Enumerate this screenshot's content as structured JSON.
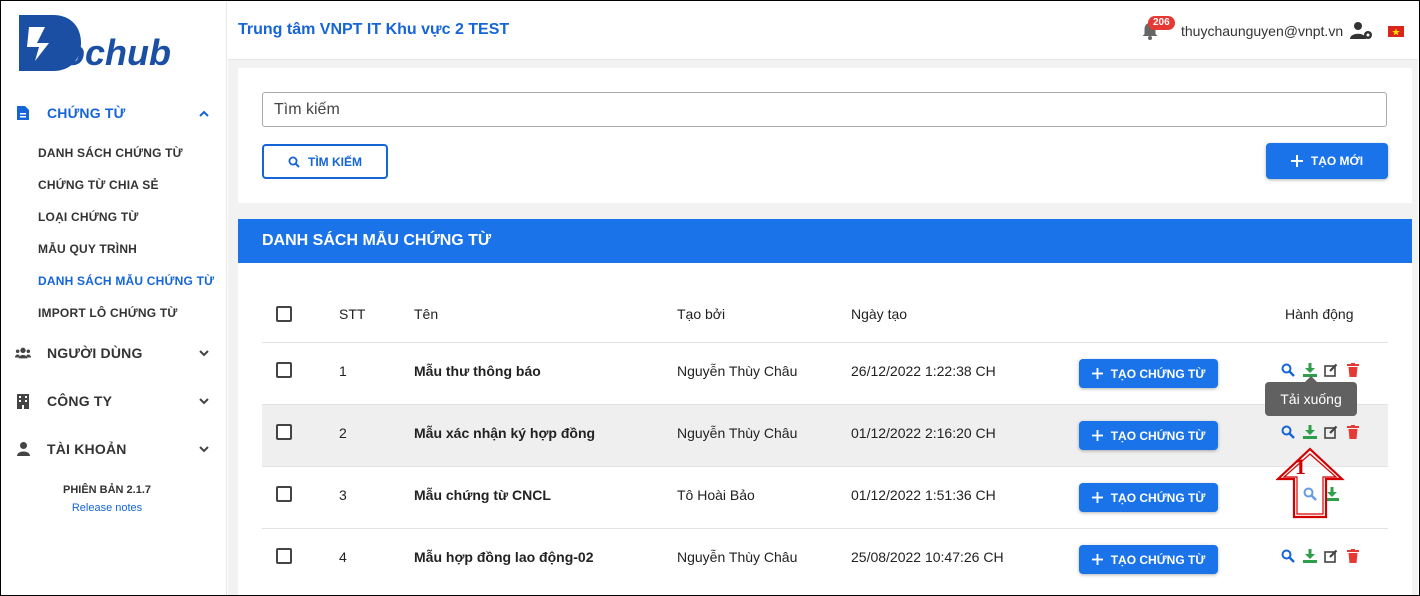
{
  "sidebar": {
    "logo_text": "Dochub",
    "groups": [
      {
        "label": "CHỨNG TỪ",
        "icon": "document-icon",
        "expanded": true
      },
      {
        "label": "NGƯỜI DÙNG",
        "icon": "users-icon",
        "expanded": false
      },
      {
        "label": "CÔNG TY",
        "icon": "building-icon",
        "expanded": false
      },
      {
        "label": "TÀI KHOẢN",
        "icon": "user-icon",
        "expanded": false
      }
    ],
    "subitems": [
      {
        "label": "DANH SÁCH CHỨNG TỪ",
        "active": false
      },
      {
        "label": "CHỨNG TỪ CHIA SẺ",
        "active": false
      },
      {
        "label": "LOẠI CHỨNG TỪ",
        "active": false
      },
      {
        "label": "MẪU QUY TRÌNH",
        "active": false
      },
      {
        "label": "DANH SÁCH MẪU CHỨNG TỪ",
        "active": true
      },
      {
        "label": "IMPORT LÔ CHỨNG TỪ",
        "active": false
      }
    ],
    "version": "PHIÊN BẢN 2.1.7",
    "release_notes": "Release notes"
  },
  "header": {
    "title": "Trung tâm VNPT IT Khu vực 2 TEST",
    "notification_count": "206",
    "user_email": "thuychaunguyen@vnpt.vn",
    "language_flag": "vietnam-flag-icon"
  },
  "search": {
    "placeholder": "Tìm kiếm",
    "search_button": "TÌM KIẾM",
    "create_button": "TẠO MỚI"
  },
  "table": {
    "title": "DANH SÁCH MẪU CHỨNG TỪ",
    "columns": [
      "STT",
      "Tên",
      "Tạo bởi",
      "Ngày tạo",
      "Hành động"
    ],
    "create_doc_label": "TẠO CHỨNG TỪ",
    "rows": [
      {
        "stt": "1",
        "name": "Mẫu thư thông báo",
        "created_by": "Nguyễn Thùy Châu",
        "created_at": "26/12/2022 1:22:38 CH",
        "actions": [
          "view",
          "download",
          "edit",
          "delete"
        ]
      },
      {
        "stt": "2",
        "name": "Mẫu xác nhận ký hợp đồng",
        "created_by": "Nguyễn Thùy Châu",
        "created_at": "01/12/2022 2:16:20 CH",
        "actions": [
          "view",
          "download",
          "edit",
          "delete"
        ]
      },
      {
        "stt": "3",
        "name": "Mẫu chứng từ CNCL",
        "created_by": "Tô Hoài Bảo",
        "created_at": "01/12/2022 1:51:36 CH",
        "actions": [
          "view",
          "download"
        ]
      },
      {
        "stt": "4",
        "name": "Mẫu hợp đồng lao động-02",
        "created_by": "Nguyễn Thùy Châu",
        "created_at": "25/08/2022 10:47:26 CH",
        "actions": [
          "view",
          "download",
          "edit",
          "delete"
        ]
      }
    ],
    "tooltip": "Tải xuống"
  },
  "annotation": {
    "step_number": "1"
  },
  "colors": {
    "primary": "#1a73e8",
    "danger": "#e53935",
    "success": "#2e9e4b",
    "annotation": "#d40000"
  }
}
